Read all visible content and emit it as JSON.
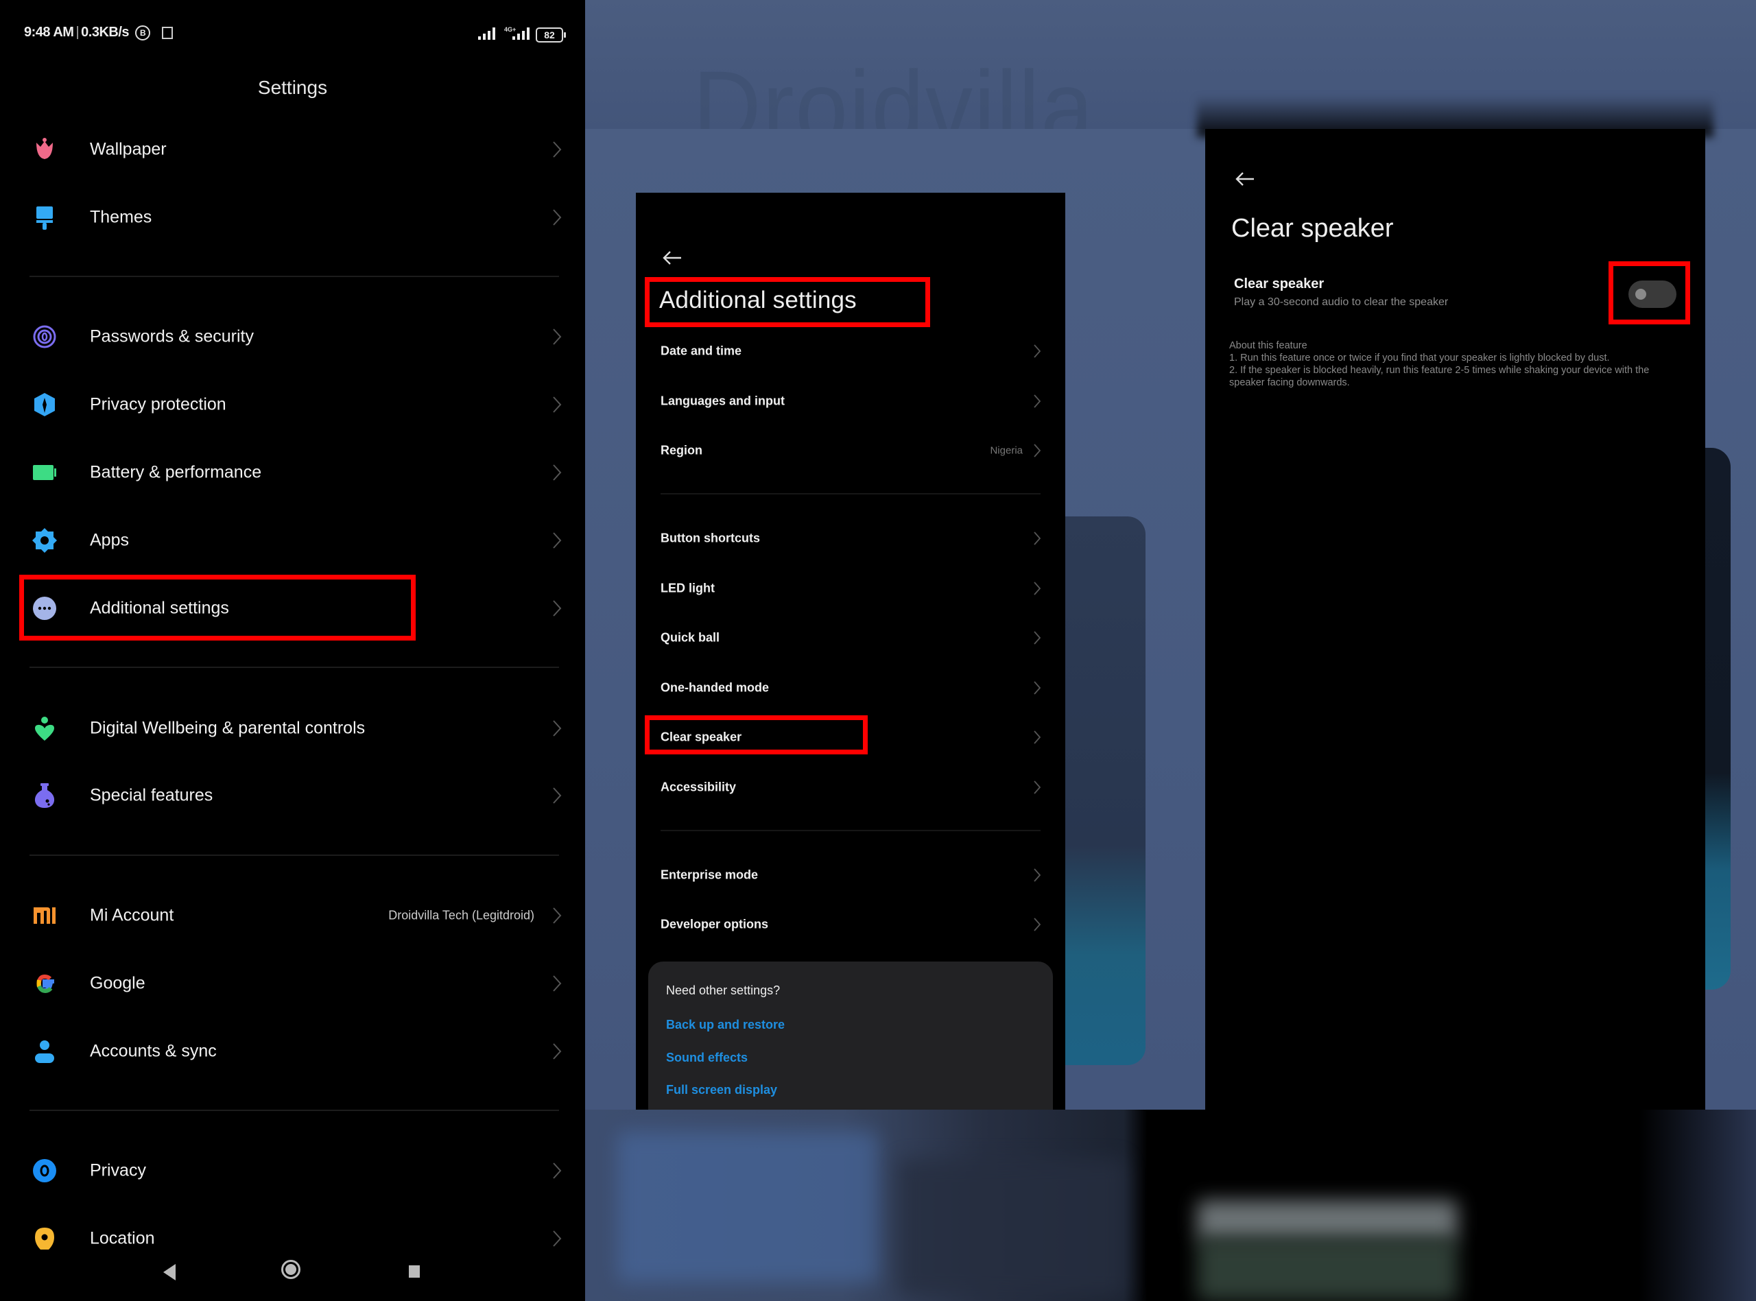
{
  "background": {
    "watermark": "Droidvilla"
  },
  "left_panel": {
    "status_bar": {
      "time": "9:48 AM",
      "speed": "0.3KB/s",
      "b_badge": "B",
      "network": "4G+",
      "battery": "82"
    },
    "title": "Settings",
    "items": [
      {
        "label": "Wallpaper",
        "icon": "tulip-icon",
        "color": "#f06a8a"
      },
      {
        "label": "Themes",
        "icon": "paintbrush-icon",
        "color": "#33aaf5"
      },
      {
        "label": "Passwords & security",
        "icon": "fingerprint-icon",
        "color": "#7b6df0"
      },
      {
        "label": "Privacy protection",
        "icon": "shield-icon",
        "color": "#34a6f5"
      },
      {
        "label": "Battery & performance",
        "icon": "battery-icon",
        "color": "#3ddc84"
      },
      {
        "label": "Apps",
        "icon": "gear-icon",
        "color": "#33aaf5"
      },
      {
        "label": "Additional settings",
        "icon": "more-dots-icon",
        "color": "#a4b4e8",
        "highlighted": true
      },
      {
        "label": "Digital Wellbeing & parental controls",
        "icon": "wellbeing-heart-icon",
        "color": "#3ddc84"
      },
      {
        "label": "Special features",
        "icon": "flask-icon",
        "color": "#7b6df0"
      },
      {
        "label": "Mi Account",
        "icon": "mi-logo-icon",
        "color": "#f7932e",
        "value": "Droidvilla Tech (Legitdroid)"
      },
      {
        "label": "Google",
        "icon": "google-g-icon"
      },
      {
        "label": "Accounts & sync",
        "icon": "person-icon",
        "color": "#33aaf5"
      },
      {
        "label": "Privacy",
        "icon": "eye-icon",
        "color": "#1a8ef5"
      },
      {
        "label": "Location",
        "icon": "location-pin-icon",
        "color": "#f7b731"
      }
    ]
  },
  "middle_panel": {
    "title": "Additional settings",
    "items": [
      {
        "label": "Date and time"
      },
      {
        "label": "Languages and input"
      },
      {
        "label": "Region",
        "value": "Nigeria"
      },
      {
        "label": "Button shortcuts"
      },
      {
        "label": "LED light"
      },
      {
        "label": "Quick ball"
      },
      {
        "label": "One-handed mode"
      },
      {
        "label": "Clear speaker",
        "highlighted": true
      },
      {
        "label": "Accessibility"
      },
      {
        "label": "Enterprise mode"
      },
      {
        "label": "Developer options"
      }
    ],
    "suggestions": {
      "heading": "Need other settings?",
      "links": [
        "Back up and restore",
        "Sound effects",
        "Full screen display"
      ],
      "link_color": "#1e8fe1"
    }
  },
  "right_panel": {
    "title": "Clear speaker",
    "toggle_label": "Clear speaker",
    "toggle_subtitle": "Play a 30-second audio to clear the speaker",
    "toggle_on": false,
    "about": {
      "heading": "About this feature",
      "line1": "1. Run this feature once or twice if you find that your speaker is lightly blocked by dust.",
      "line2": "2. If the speaker is blocked heavily, run this feature 2-5 times while shaking your device with the speaker facing downwards."
    }
  },
  "annotation_color": "#ff0000"
}
